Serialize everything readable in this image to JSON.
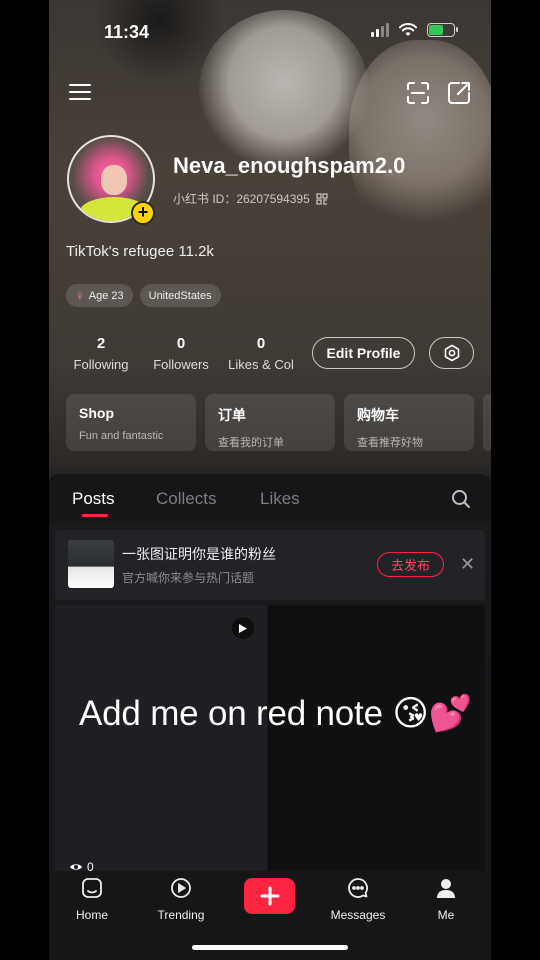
{
  "status": {
    "time": "11:34"
  },
  "profile": {
    "username": "Neva_enoughspam2.0",
    "id_label": "小红书 ID：26207594395",
    "bio": "TikTok's refugee 11.2k",
    "tags": [
      "Age 23",
      "UnitedStates"
    ]
  },
  "stats": [
    {
      "num": "2",
      "label": "Following"
    },
    {
      "num": "0",
      "label": "Followers"
    },
    {
      "num": "0",
      "label": "Likes & Col"
    }
  ],
  "edit_profile": "Edit Profile",
  "cards": [
    {
      "title": "Shop",
      "sub": "Fun and fantastic"
    },
    {
      "title": "订单",
      "sub": "查看我的订单"
    },
    {
      "title": "购物车",
      "sub": "查看推荐好物"
    }
  ],
  "tabs": [
    "Posts",
    "Collects",
    "Likes"
  ],
  "banner": {
    "title": "一张图证明你是谁的粉丝",
    "sub": "官方喊你来参与热门话题",
    "button": "去发布"
  },
  "post": {
    "views": "0"
  },
  "caption": "Add me on red note 😘💕",
  "nav": {
    "home": "Home",
    "trending": "Trending",
    "messages": "Messages",
    "me": "Me"
  },
  "colors": {
    "accent": "#ff2442",
    "badge": "#ffd400"
  }
}
